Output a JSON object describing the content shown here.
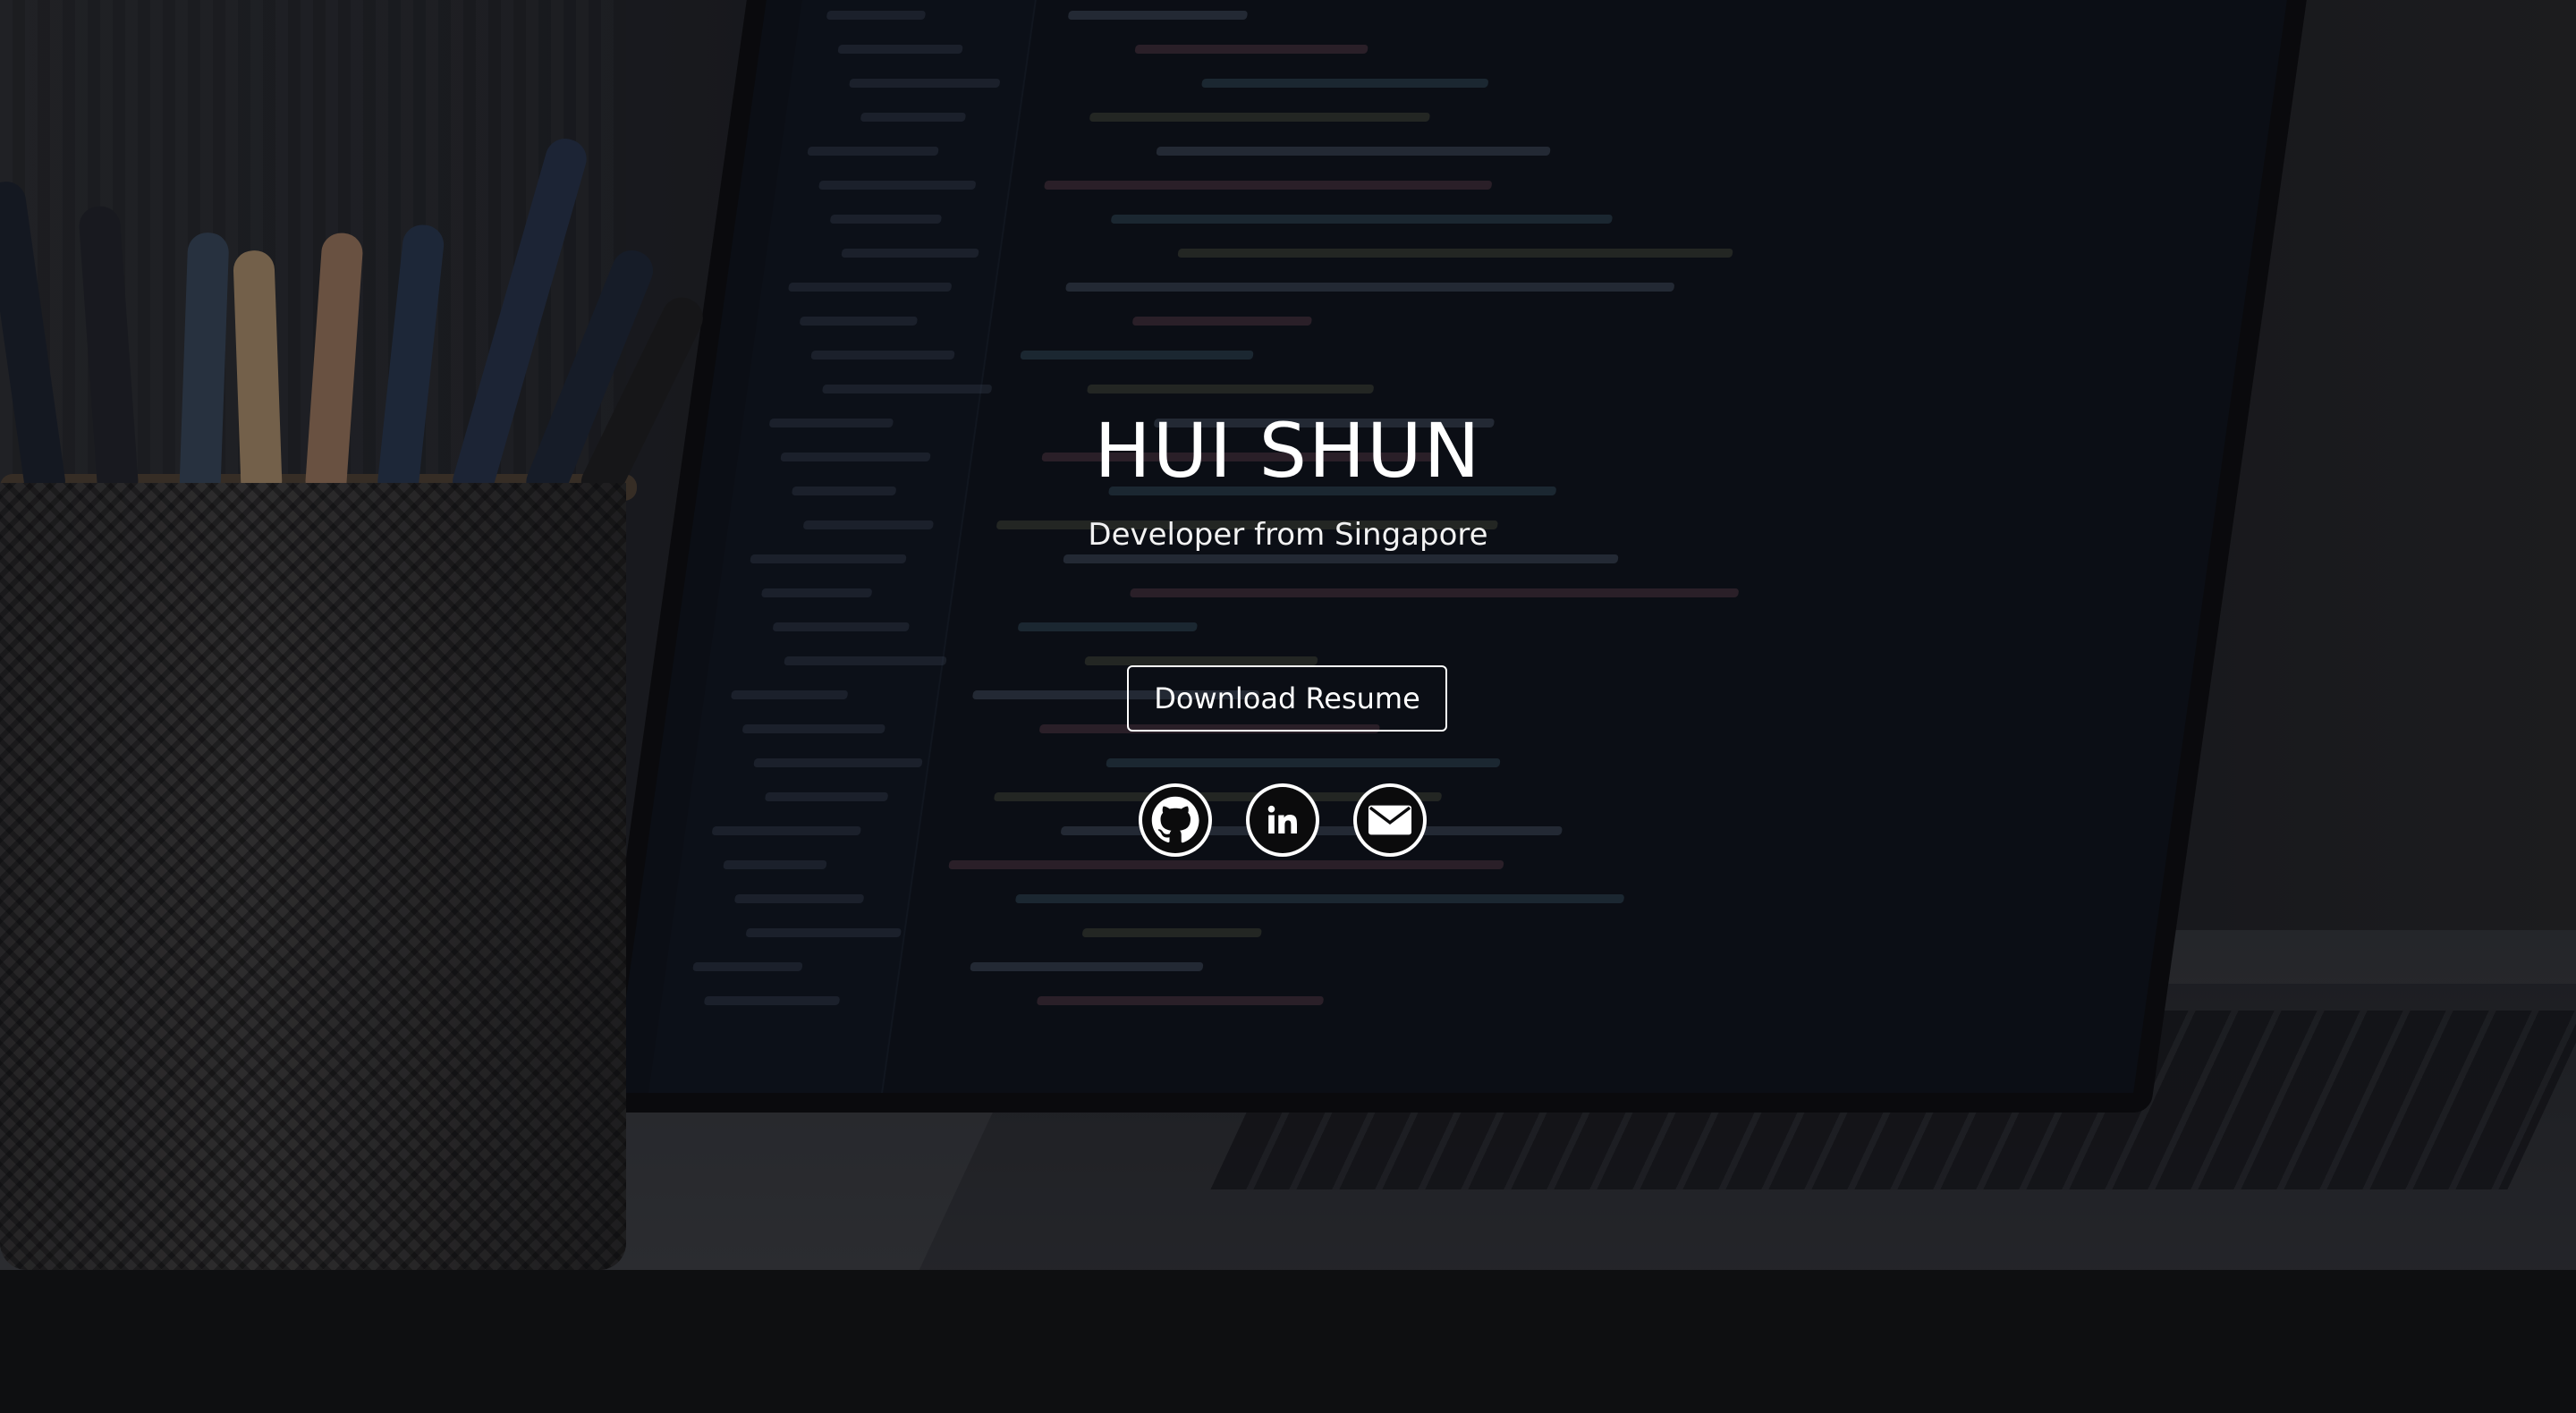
{
  "hero": {
    "name": "HUI SHUN",
    "tagline": "Developer from Singapore",
    "resume_button": "Download Resume"
  },
  "socials": [
    {
      "icon": "github-icon",
      "label": "GitHub"
    },
    {
      "icon": "linkedin-icon",
      "label": "LinkedIn"
    },
    {
      "icon": "mail-icon",
      "label": "Email"
    }
  ],
  "colors": {
    "text": "#ffffff",
    "footer_background": "#0e0f11",
    "overlay": "#0a0c10"
  }
}
